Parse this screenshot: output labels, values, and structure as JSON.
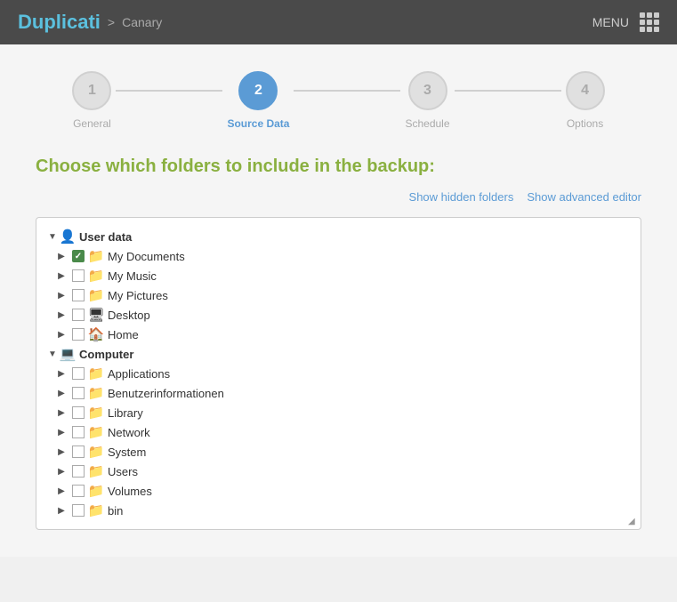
{
  "header": {
    "title": "Duplicati",
    "separator": ">",
    "subtitle": "Canary",
    "menu_label": "MENU"
  },
  "wizard": {
    "steps": [
      {
        "id": 1,
        "label": "General",
        "state": "inactive"
      },
      {
        "id": 2,
        "label": "Source Data",
        "state": "active"
      },
      {
        "id": 3,
        "label": "Schedule",
        "state": "inactive"
      },
      {
        "id": 4,
        "label": "Options",
        "state": "inactive"
      }
    ]
  },
  "page": {
    "title": "Choose which folders to include in the backup:",
    "links": {
      "show_hidden": "Show hidden folders",
      "show_advanced": "Show advanced editor"
    }
  },
  "tree": {
    "items": [
      {
        "id": "user-data",
        "label": "User data",
        "level": 0,
        "icon": "user",
        "type": "root",
        "expanded": true
      },
      {
        "id": "my-documents",
        "label": "My Documents",
        "level": 1,
        "icon": "folder-yellow",
        "checked": true,
        "expanded": true
      },
      {
        "id": "my-music",
        "label": "My Music",
        "level": 1,
        "icon": "folder-yellow",
        "expanded": false
      },
      {
        "id": "my-pictures",
        "label": "My Pictures",
        "level": 1,
        "icon": "folder-yellow",
        "expanded": false
      },
      {
        "id": "desktop",
        "label": "Desktop",
        "level": 1,
        "icon": "folder-yellow",
        "expanded": false
      },
      {
        "id": "home",
        "label": "Home",
        "level": 1,
        "icon": "folder-yellow",
        "expanded": false
      },
      {
        "id": "computer",
        "label": "Computer",
        "level": 0,
        "icon": "computer",
        "type": "root",
        "expanded": true
      },
      {
        "id": "applications",
        "label": "Applications",
        "level": 1,
        "icon": "folder-yellow",
        "expanded": false
      },
      {
        "id": "benutzerinformationen",
        "label": "Benutzerinformationen",
        "level": 1,
        "icon": "folder-yellow",
        "expanded": false
      },
      {
        "id": "library",
        "label": "Library",
        "level": 1,
        "icon": "folder-yellow",
        "expanded": false
      },
      {
        "id": "network",
        "label": "Network",
        "level": 1,
        "icon": "folder-yellow",
        "expanded": false
      },
      {
        "id": "system",
        "label": "System",
        "level": 1,
        "icon": "folder-yellow",
        "expanded": false
      },
      {
        "id": "users",
        "label": "Users",
        "level": 1,
        "icon": "folder-yellow",
        "expanded": false
      },
      {
        "id": "volumes",
        "label": "Volumes",
        "level": 1,
        "icon": "folder-yellow",
        "expanded": false
      },
      {
        "id": "bin",
        "label": "bin",
        "level": 1,
        "icon": "folder-yellow",
        "expanded": false
      }
    ]
  }
}
